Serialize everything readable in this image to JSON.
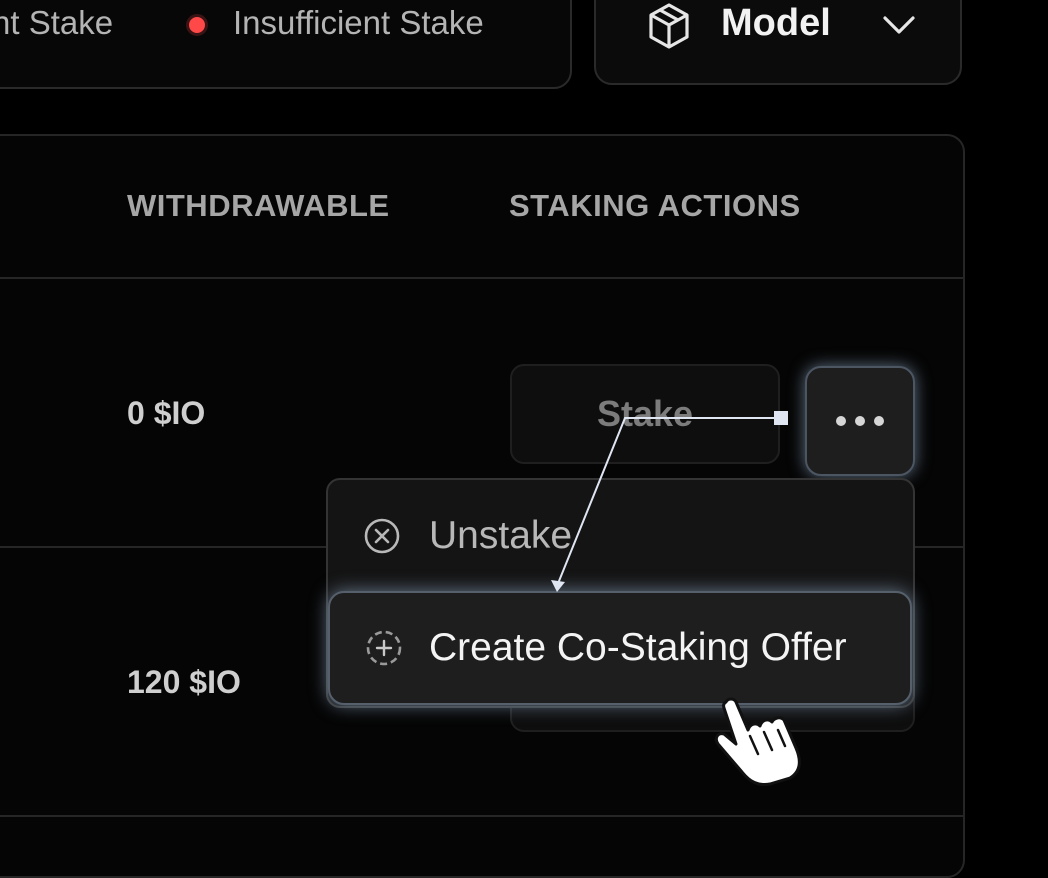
{
  "legend": {
    "items": [
      {
        "label": "nt Stake",
        "color": null
      },
      {
        "label": "Insufficient Stake",
        "color": "#ff4848"
      }
    ]
  },
  "model_filter": {
    "label": "Model",
    "icon": "cube-icon",
    "chevron": "chevron-down-icon"
  },
  "table": {
    "headers": [
      "WITHDRAWABLE",
      "STAKING ACTIONS"
    ],
    "rows": [
      {
        "withdrawable": "0 $IO",
        "action": "Stake"
      },
      {
        "withdrawable": "120 $IO",
        "action": ""
      }
    ]
  },
  "actions_menu": {
    "items": [
      {
        "label": "Unstake",
        "icon": "x-circle-icon"
      },
      {
        "label": "Create Co-Staking Offer",
        "icon": "plus-circle-dashed-icon"
      }
    ]
  },
  "colors": {
    "background": "#000000",
    "status_red": "#ff4848",
    "highlight_glow": "#aac8eb"
  }
}
